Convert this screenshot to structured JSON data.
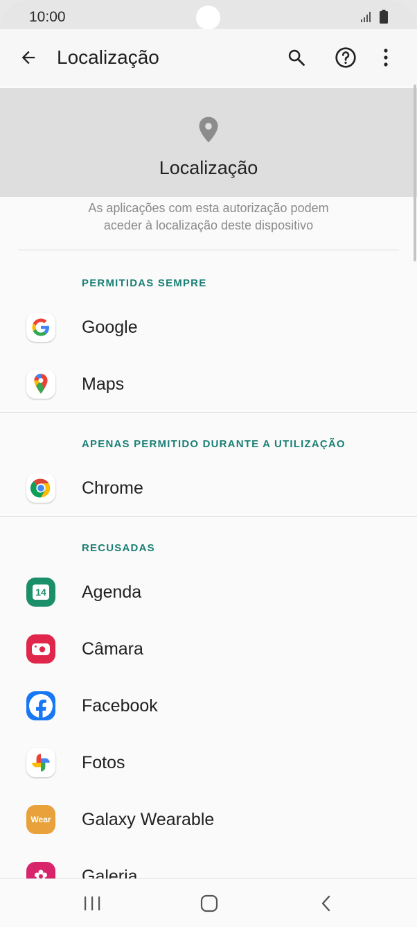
{
  "status_bar": {
    "time": "10:00"
  },
  "app_bar": {
    "title": "Localização"
  },
  "header": {
    "title": "Localização",
    "description_line1": "As aplicações com esta autorização podem",
    "description_line2": "aceder à localização deste dispositivo"
  },
  "sections": {
    "always": {
      "title": "PERMITIDAS SEMPRE",
      "apps": [
        {
          "label": "Google"
        },
        {
          "label": "Maps"
        }
      ]
    },
    "while_in_use": {
      "title": "APENAS PERMITIDO DURANTE A UTILIZAÇÃO",
      "apps": [
        {
          "label": "Chrome"
        }
      ]
    },
    "denied": {
      "title": "RECUSADAS",
      "apps": [
        {
          "label": "Agenda",
          "icon_text": "14"
        },
        {
          "label": "Câmara"
        },
        {
          "label": "Facebook"
        },
        {
          "label": "Fotos"
        },
        {
          "label": "Galaxy Wearable",
          "icon_text": "Wear"
        },
        {
          "label": "Galeria"
        }
      ]
    }
  },
  "colors": {
    "accent": "#1a7f74",
    "agenda": "#1b8f6a",
    "camera": "#e0264a",
    "facebook": "#1877f2",
    "wear": "#e9a23b",
    "gallery": "#d8246a"
  }
}
